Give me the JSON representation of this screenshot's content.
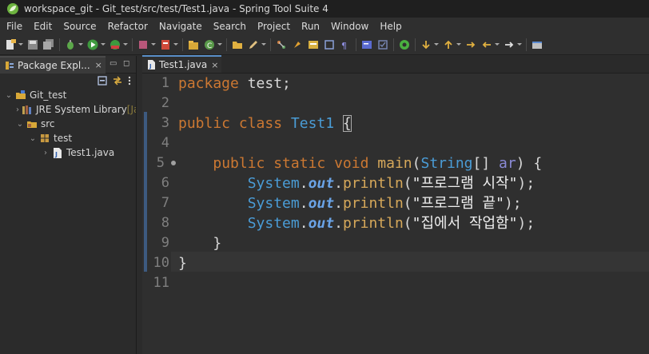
{
  "window": {
    "title": "workspace_git - Git_test/src/test/Test1.java - Spring Tool Suite 4",
    "brand_color": "#6db33f"
  },
  "menu": {
    "items": [
      "File",
      "Edit",
      "Source",
      "Refactor",
      "Navigate",
      "Search",
      "Project",
      "Run",
      "Window",
      "Help"
    ]
  },
  "toolbar": {
    "icons": [
      "new-icon",
      "save-icon",
      "save-all-icon",
      "debug-icon",
      "run-icon",
      "coverage-icon",
      "stop-icon",
      "server-icon",
      "new-java-project-icon",
      "new-class-icon",
      "open-folder-icon",
      "pencil-icon",
      "git-icon",
      "pin-icon",
      "open-type-icon",
      "search-icon",
      "paragraph-icon",
      "console-icon",
      "spring-boot-icon",
      "next-annotation-icon",
      "prev-annotation-icon",
      "back-icon",
      "forward-icon",
      "perspective-icon"
    ]
  },
  "package_explorer": {
    "tab_label": "Package Expl...",
    "close_glyph": "×",
    "minimize_glyph": "▭",
    "maximize_glyph": "◻",
    "tree": [
      {
        "label": "Git_test",
        "suffix": "",
        "depth": 0,
        "chevron": "⌄",
        "icon": "project-icon"
      },
      {
        "label": "JRE System Library",
        "suffix": " [Ja",
        "depth": 1,
        "chevron": "›",
        "icon": "library-icon"
      },
      {
        "label": "src",
        "suffix": "",
        "depth": 1,
        "chevron": "⌄",
        "icon": "source-folder-icon"
      },
      {
        "label": "test",
        "suffix": "",
        "depth": 2,
        "chevron": "⌄",
        "icon": "package-icon"
      },
      {
        "label": "Test1.java",
        "suffix": "",
        "depth": 3,
        "chevron": "›",
        "icon": "java-file-icon"
      }
    ]
  },
  "editor": {
    "tab_label": "Test1.java",
    "close_glyph": "×",
    "line_numbers": [
      "1",
      "2",
      "3",
      "4",
      "5",
      "6",
      "7",
      "8",
      "9",
      "10",
      "11"
    ],
    "lines": {
      "l1_kw": "package",
      "l1_rest": " test;",
      "l3_kw": "public class",
      "l3_sp": " ",
      "l3_cls": "Test1",
      "l3_sp2": " ",
      "l3_brace": "{",
      "l5_indent": "    ",
      "l5_kw": "public static void",
      "l5_sp": " ",
      "l5_meth": "main",
      "l5_paren": "(",
      "l5_type": "String",
      "l5_arr": "[] ",
      "l5_param": "ar",
      "l5_close": ") {",
      "print_indent": "        ",
      "print_cls": "System",
      "print_dot": ".",
      "print_field": "out",
      "print_dot2": ".",
      "print_meth": "println",
      "print_open": "(",
      "print_close": ");",
      "l6_str": "\"프로그램 시작\"",
      "l7_str": "\"프로그램 끝\"",
      "l8_str": "\"집에서 작업함\"",
      "l9_text": "    }",
      "l10_text": "}"
    }
  }
}
